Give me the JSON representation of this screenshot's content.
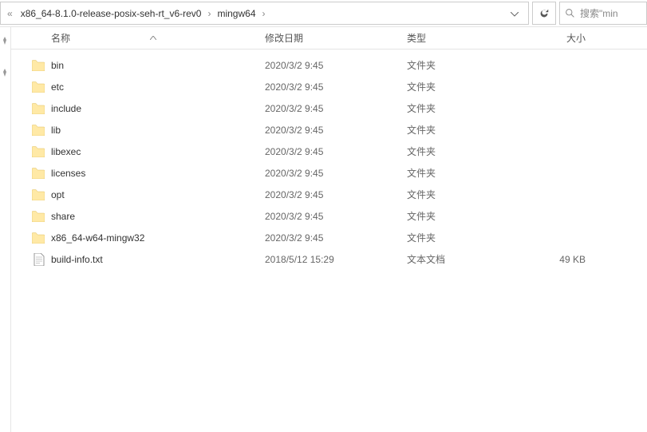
{
  "breadcrumb": {
    "overflow_indicator": "«",
    "items": [
      "x86_64-8.1.0-release-posix-seh-rt_v6-rev0",
      "mingw64"
    ],
    "separator": "›"
  },
  "search": {
    "placeholder": "搜索\"min"
  },
  "columns": {
    "name": "名称",
    "date": "修改日期",
    "type": "类型",
    "size": "大小"
  },
  "files": [
    {
      "icon": "folder",
      "name": "bin",
      "date": "2020/3/2 9:45",
      "type": "文件夹",
      "size": ""
    },
    {
      "icon": "folder",
      "name": "etc",
      "date": "2020/3/2 9:45",
      "type": "文件夹",
      "size": ""
    },
    {
      "icon": "folder",
      "name": "include",
      "date": "2020/3/2 9:45",
      "type": "文件夹",
      "size": ""
    },
    {
      "icon": "folder",
      "name": "lib",
      "date": "2020/3/2 9:45",
      "type": "文件夹",
      "size": ""
    },
    {
      "icon": "folder",
      "name": "libexec",
      "date": "2020/3/2 9:45",
      "type": "文件夹",
      "size": ""
    },
    {
      "icon": "folder",
      "name": "licenses",
      "date": "2020/3/2 9:45",
      "type": "文件夹",
      "size": ""
    },
    {
      "icon": "folder",
      "name": "opt",
      "date": "2020/3/2 9:45",
      "type": "文件夹",
      "size": ""
    },
    {
      "icon": "folder",
      "name": "share",
      "date": "2020/3/2 9:45",
      "type": "文件夹",
      "size": ""
    },
    {
      "icon": "folder",
      "name": "x86_64-w64-mingw32",
      "date": "2020/3/2 9:45",
      "type": "文件夹",
      "size": ""
    },
    {
      "icon": "file",
      "name": "build-info.txt",
      "date": "2018/5/12 15:29",
      "type": "文本文档",
      "size": "49 KB"
    }
  ]
}
